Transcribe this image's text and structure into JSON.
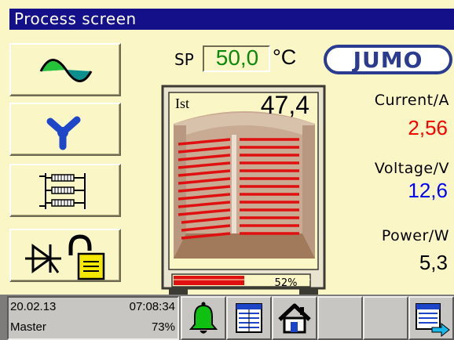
{
  "window": {
    "title": "Process screen"
  },
  "left_buttons": [
    {
      "icon": "sine-wave-icon"
    },
    {
      "icon": "y-branch-icon"
    },
    {
      "icon": "heater-coils-icon"
    },
    {
      "icon": "thyristor-lock-icon"
    }
  ],
  "setpoint": {
    "label": "SP",
    "value": "50,0",
    "unit": "°C"
  },
  "logo": {
    "text": "JUMO"
  },
  "furnace": {
    "actual_label": "Ist",
    "actual_value": "47,4",
    "output_percent_label": "52%",
    "output_fraction": 0.52
  },
  "readouts": [
    {
      "label": "Current/A",
      "value": "2,56",
      "color": "#ff0000"
    },
    {
      "label": "Voltage/V",
      "value": "12,6",
      "color": "#0000ff"
    },
    {
      "label": "Power/W",
      "value": "5,3",
      "color": "#000000"
    }
  ],
  "status": {
    "date": "20.02.13",
    "time": "07:08:34",
    "user": "Master",
    "percent": "73%"
  },
  "bottom_buttons": [
    "bell-alarm-icon",
    "data-table-icon",
    "home-icon",
    "empty",
    "empty",
    "export-table-icon"
  ],
  "colors": {
    "background": "#fbf6c6",
    "title_bar": "#14108a",
    "setpoint_text": "#0a8a0a",
    "logo": "#2b3b8f",
    "bar_fill": "#e01010"
  }
}
